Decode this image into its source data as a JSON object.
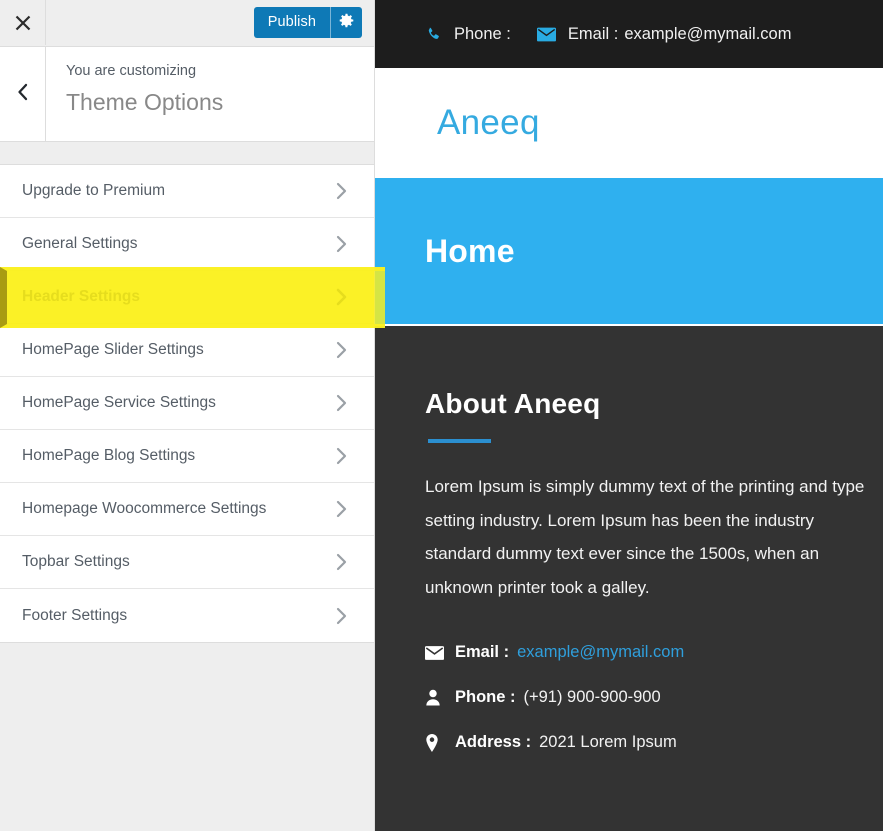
{
  "customizer": {
    "close_label": "Close",
    "publish_label": "Publish",
    "gear_label": "Publish settings",
    "back_label": "Back",
    "kicker": "You are customizing",
    "panel_title": "Theme Options",
    "menu_items": [
      {
        "label": "Upgrade to Premium",
        "highlighted": false
      },
      {
        "label": "General Settings",
        "highlighted": false
      },
      {
        "label": "Header Settings",
        "highlighted": true
      },
      {
        "label": "HomePage Slider Settings",
        "highlighted": false
      },
      {
        "label": "HomePage Service Settings",
        "highlighted": false
      },
      {
        "label": "HomePage Blog Settings",
        "highlighted": false
      },
      {
        "label": "Homepage Woocommerce Settings",
        "highlighted": false
      },
      {
        "label": "Topbar Settings",
        "highlighted": false
      },
      {
        "label": "Footer Settings",
        "highlighted": false
      }
    ]
  },
  "preview": {
    "topbar": {
      "phone_label": "Phone :",
      "phone_value": "",
      "email_label": "Email :",
      "email_value": "example@mymail.com"
    },
    "site_title": "Aneeq",
    "banner_title": "Home",
    "about": {
      "heading": "About Aneeq",
      "body": "Lorem Ipsum is simply dummy text of the printing and type setting industry. Lorem Ipsum has been the industry standard dummy text ever since the 1500s, when an unknown printer took a galley.",
      "contacts": [
        {
          "icon": "envelope-icon",
          "label": "Email :",
          "value": "example@mymail.com",
          "is_link": true
        },
        {
          "icon": "person-icon",
          "label": "Phone :",
          "value": "(+91) 900-900-900",
          "is_link": false
        },
        {
          "icon": "map-pin-icon",
          "label": "Address :",
          "value": "2021 Lorem Ipsum",
          "is_link": false
        }
      ]
    }
  },
  "colors": {
    "publish_blue": "#0e79b6",
    "highlight_yellow": "#fbf14b",
    "highlight_border": "#a99c12",
    "banner_blue": "#2fb0ef",
    "accent_blue": "#35aae0",
    "link_blue": "#2f9fdc",
    "dark_section": "#333333",
    "topbar_dark": "#1d1d1d"
  }
}
